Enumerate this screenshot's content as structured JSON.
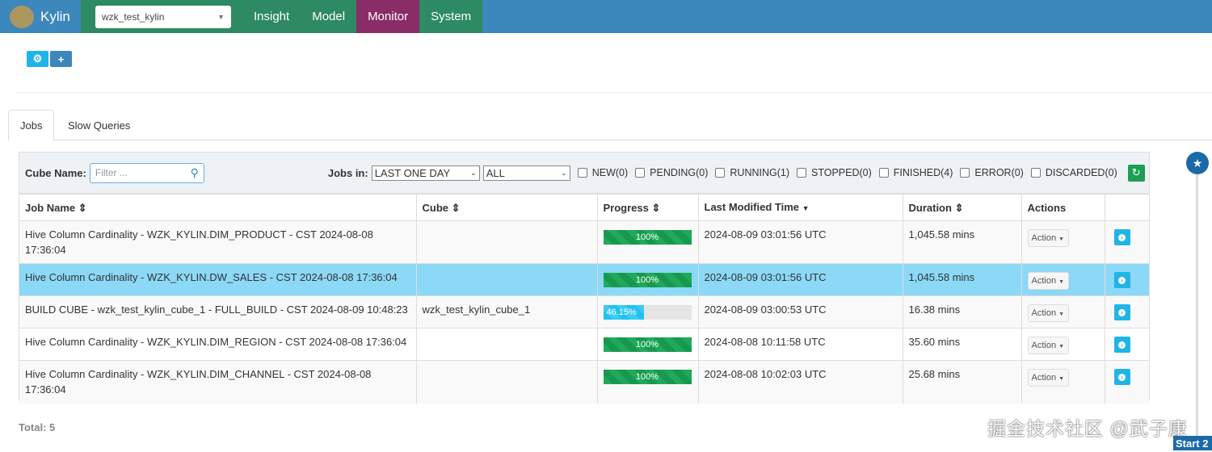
{
  "nav": {
    "brand": "Kylin",
    "project": "wzk_test_kylin",
    "items": [
      "Insight",
      "Model",
      "Monitor",
      "System"
    ],
    "active": "Monitor"
  },
  "tabs": [
    "Jobs",
    "Slow Queries"
  ],
  "filter": {
    "cube_label": "Cube Name:",
    "placeholder": "Filter ...",
    "jobs_in_label": "Jobs in:",
    "time_range": "LAST ONE DAY",
    "status_select": "ALL",
    "statuses": [
      "NEW(0)",
      "PENDING(0)",
      "RUNNING(1)",
      "STOPPED(0)",
      "FINISHED(4)",
      "ERROR(0)",
      "DISCARDED(0)"
    ]
  },
  "table": {
    "headers": [
      "Job Name",
      "Cube",
      "Progress",
      "Last Modified Time",
      "Duration",
      "Actions"
    ],
    "rows": [
      {
        "name": "Hive Column Cardinality - WZK_KYLIN.DIM_PRODUCT - CST 2024-08-08 17:36:04",
        "cube": "",
        "progress": 100,
        "progress_label": "100%",
        "modified": "2024-08-09 03:01:56 UTC",
        "duration": "1,045.58 mins",
        "action": "Action"
      },
      {
        "name": "Hive Column Cardinality - WZK_KYLIN.DW_SALES - CST 2024-08-08 17:36:04",
        "cube": "",
        "progress": 100,
        "progress_label": "100%",
        "modified": "2024-08-09 03:01:56 UTC",
        "duration": "1,045.58 mins",
        "action": "Action"
      },
      {
        "name": "BUILD CUBE - wzk_test_kylin_cube_1 - FULL_BUILD - CST 2024-08-09 10:48:23",
        "cube": "wzk_test_kylin_cube_1",
        "progress": 46.15,
        "progress_label": "46.15%",
        "modified": "2024-08-09 03:00:53 UTC",
        "duration": "16.38 mins",
        "action": "Action"
      },
      {
        "name": "Hive Column Cardinality - WZK_KYLIN.DIM_REGION - CST 2024-08-08 17:36:04",
        "cube": "",
        "progress": 100,
        "progress_label": "100%",
        "modified": "2024-08-08 10:11:58 UTC",
        "duration": "35.60 mins",
        "action": "Action"
      },
      {
        "name": "Hive Column Cardinality - WZK_KYLIN.DIM_CHANNEL - CST 2024-08-08 17:36:04",
        "cube": "",
        "progress": 100,
        "progress_label": "100%",
        "modified": "2024-08-08 10:02:03 UTC",
        "duration": "25.68 mins",
        "action": "Action"
      }
    ]
  },
  "total": "Total: 5",
  "watermark": "掘金技术社区 @武子康",
  "start_badge": "Start 2"
}
